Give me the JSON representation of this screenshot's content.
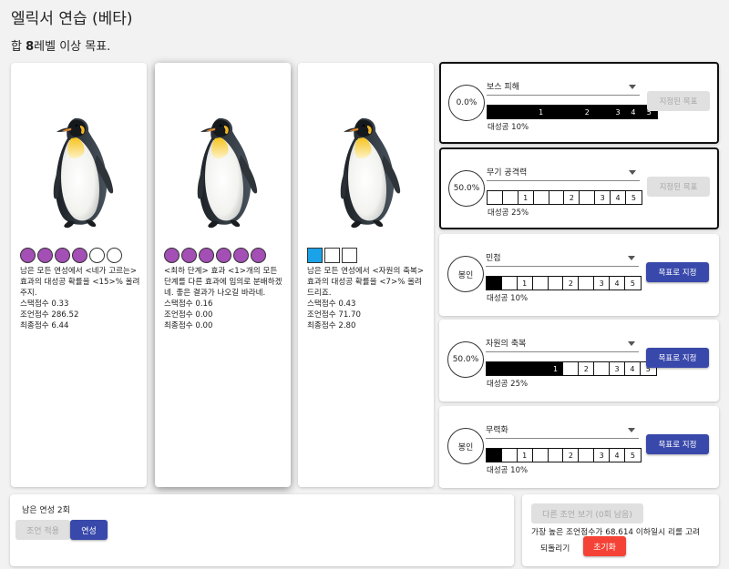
{
  "page": {
    "title": "엘릭서 연습 (베타)",
    "goal_prefix": "합 ",
    "goal_level": "8",
    "goal_suffix": "레벨 이상 목표."
  },
  "colors": {
    "indicator_purple": "#a34fb5",
    "indicator_blue": "#1aa3e8",
    "primary_button": "#3949ab",
    "reset_button": "#f44336",
    "disabled_button": "#e0e0e0"
  },
  "sages": [
    {
      "indicator_shape": "circle",
      "indicator_states": [
        1,
        1,
        1,
        1,
        0,
        0
      ],
      "description": "남은 모든 연성에서 <네가 고르는> 효과의 대성공 확률을 <15>% 올려주지.",
      "stack_score": "스택점수 0.33",
      "advice_score": "조언점수 286.52",
      "final_score": "최종점수 6.44"
    },
    {
      "indicator_shape": "circle",
      "indicator_states": [
        1,
        1,
        1,
        1,
        1,
        1
      ],
      "description": "<최하 단계> 효과 <1>개의 모든 단계를 다른 효과에 임의로 분배하겠네. 좋은 결과가 나오길 바라네.",
      "stack_score": "스택점수 0.16",
      "advice_score": "조언점수 0.00",
      "final_score": "최종점수 0.00"
    },
    {
      "indicator_shape": "square",
      "indicator_states": [
        1,
        0,
        0
      ],
      "description": "남은 모든 연성에서 <자원의 축복> 효과의 대성공 확률을 <7>% 올려드리죠.",
      "stack_score": "스택점수 0.43",
      "advice_score": "조언점수 71.70",
      "final_score": "최종점수 2.80"
    }
  ],
  "effects": [
    {
      "status": "0.0%",
      "name": "보스 피해",
      "cells": [
        "",
        "",
        "",
        "1",
        "",
        "",
        "2",
        "",
        "3",
        "4",
        "5"
      ],
      "filled": 11,
      "rate": "대성공 10%",
      "button": "지정된 목표",
      "button_disabled": true
    },
    {
      "status": "50.0%",
      "name": "무기 공격력",
      "cells": [
        "",
        "",
        "1",
        "",
        "",
        "2",
        "",
        "3",
        "4",
        "5"
      ],
      "filled": 0,
      "rate": "대성공 25%",
      "button": "지정된 목표",
      "button_disabled": true
    },
    {
      "status": "봉인",
      "name": "민첩",
      "cells": [
        "",
        "",
        "1",
        "",
        "",
        "2",
        "",
        "3",
        "4",
        "5"
      ],
      "filled": 1,
      "rate": "대성공 10%",
      "button": "목표로 지정",
      "button_disabled": false
    },
    {
      "status": "50.0%",
      "name": "자원의 축복",
      "cells": [
        "",
        "",
        "",
        "",
        "1",
        "",
        "2",
        "",
        "3",
        "4",
        "5"
      ],
      "filled": 5,
      "rate": "대성공 25%",
      "button": "목표로 지정",
      "button_disabled": false
    },
    {
      "status": "봉인",
      "name": "무력화",
      "cells": [
        "",
        "",
        "1",
        "",
        "",
        "2",
        "",
        "3",
        "4",
        "5"
      ],
      "filled": 1,
      "rate": "대성공 10%",
      "button": "목표로 지정",
      "button_disabled": false
    }
  ],
  "controls": {
    "remaining": "남은 연성 2회",
    "apply_label": "조언 적용",
    "refine_label": "연성",
    "other_advice_label": "다른 조언 보기 (0회 남음)",
    "hint": "가장 높은 조언점수가 68.614 이하일시 리롤 고려",
    "undo_label": "되돌리기",
    "reset_label": "초기화"
  }
}
